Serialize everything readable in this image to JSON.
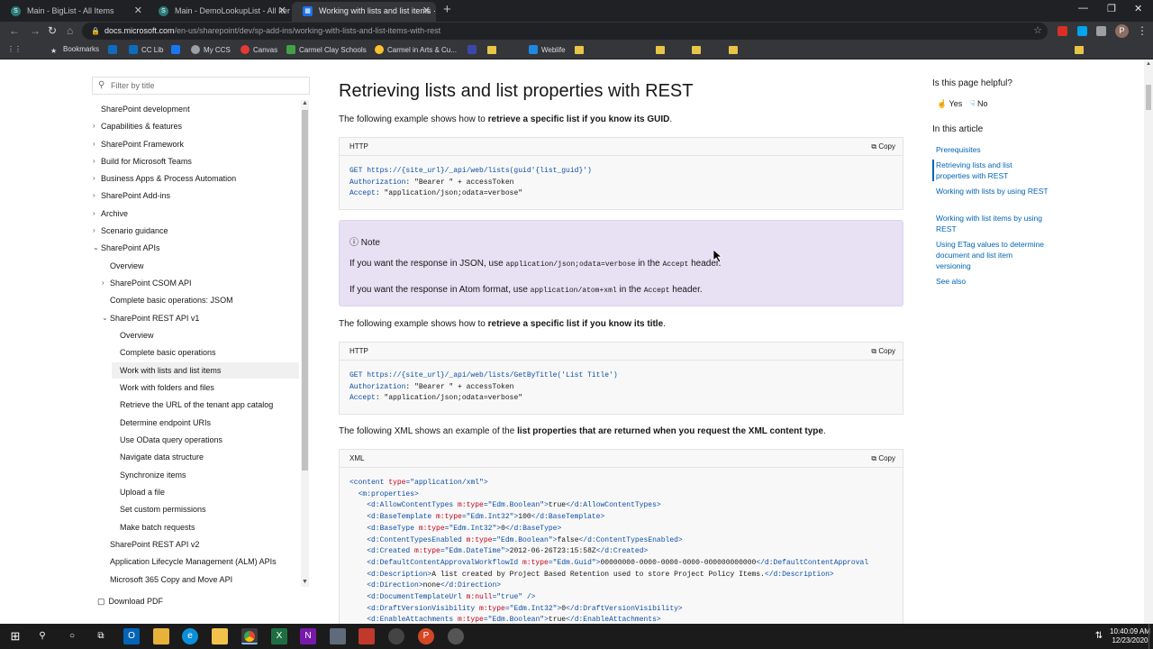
{
  "browser": {
    "tabs": [
      {
        "title": "Main - BigList - All Items",
        "icon": "sharepoint-icon"
      },
      {
        "title": "Main - DemoLookupList - All Iter",
        "icon": "sharepoint-icon"
      },
      {
        "title": "Working with lists and list items ·",
        "icon": "docs-icon"
      }
    ],
    "url_domain": "docs.microsoft.com",
    "url_path": "/en-us/sharepoint/dev/sp-add-ins/working-with-lists-and-list-items-with-rest",
    "profile_initial": "P",
    "bookmarks": [
      "Bookmarks",
      "CC Lib",
      "My CCS",
      "Canvas",
      "Carmel Clay Schools",
      "Carmel in Arts & Cu...",
      "Weblife"
    ]
  },
  "sidebar": {
    "filter_placeholder": "Filter by title",
    "download_pdf": "Download PDF",
    "items": [
      {
        "label": "SharePoint development"
      },
      {
        "label": "Capabilities & features"
      },
      {
        "label": "SharePoint Framework"
      },
      {
        "label": "Build for Microsoft Teams"
      },
      {
        "label": "Business Apps & Process Automation"
      },
      {
        "label": "SharePoint Add-ins"
      },
      {
        "label": "Archive"
      },
      {
        "label": "Scenario guidance"
      },
      {
        "label": "SharePoint APIs"
      },
      {
        "label": "Overview"
      },
      {
        "label": "SharePoint CSOM API"
      },
      {
        "label": "Complete basic operations: JSOM"
      },
      {
        "label": "SharePoint REST API v1"
      },
      {
        "label": "Overview"
      },
      {
        "label": "Complete basic operations"
      },
      {
        "label": "Work with lists and list items"
      },
      {
        "label": "Work with folders and files"
      },
      {
        "label": "Retrieve the URL of the tenant app catalog"
      },
      {
        "label": "Determine endpoint URIs"
      },
      {
        "label": "Use OData query operations"
      },
      {
        "label": "Navigate data structure"
      },
      {
        "label": "Synchronize items"
      },
      {
        "label": "Upload a file"
      },
      {
        "label": "Set custom permissions"
      },
      {
        "label": "Make batch requests"
      },
      {
        "label": "SharePoint REST API v2"
      },
      {
        "label": "Application Lifecycle Management (ALM) APIs"
      },
      {
        "label": "Microsoft 365 Copy and Move API"
      }
    ]
  },
  "main": {
    "title": "Retrieving lists and list properties with REST",
    "p1_a": "The following example shows how to ",
    "p1_b": "retrieve a specific list if you know its GUID",
    "p1_c": ".",
    "copy": "Copy",
    "code1_lang": "HTTP",
    "code1": {
      "l1a": "GET ",
      "l1b": "https://{site_url}/_api/web/lists(guid'{list_guid}')",
      "l2a": "Authorization",
      "l2b": ": \"Bearer \" + accessToken",
      "l3a": "Accept",
      "l3b": ": \"application/json;odata=verbose\""
    },
    "note_title": "Note",
    "note_l1_a": "If you want the response in JSON, use ",
    "note_l1_code": "application/json;odata=verbose",
    "note_l1_b": " in the ",
    "note_l1_code2": "Accept",
    "note_l1_c": " header.",
    "note_l2_a": "If you want the response in Atom format, use ",
    "note_l2_code": "application/atom+xml",
    "note_l2_b": " in the ",
    "note_l2_code2": "Accept",
    "note_l2_c": " header.",
    "p2_a": "The following example shows how to ",
    "p2_b": "retrieve a specific list if you know its title",
    "p2_c": ".",
    "code2_lang": "HTTP",
    "code2": {
      "l1a": "GET ",
      "l1b": "https://{site_url}/_api/web/lists/GetByTitle('List Title')",
      "l2a": "Authorization",
      "l2b": ": \"Bearer \" + accessToken",
      "l3a": "Accept",
      "l3b": ": \"application/json;odata=verbose\""
    },
    "p3_a": "The following XML shows an example of the ",
    "p3_b": "list properties that are returned when you request the XML content type",
    "p3_c": ".",
    "code3_lang": "XML",
    "xml": [
      {
        "pre": "",
        "open": "<content ",
        "attrs": [
          [
            "type",
            "\"application/xml\""
          ]
        ],
        "close": ">",
        "text": "",
        "end": ""
      },
      {
        "pre": "  ",
        "open": "<m:properties",
        "attrs": [],
        "close": ">",
        "text": "",
        "end": ""
      },
      {
        "pre": "    ",
        "open": "<d:AllowContentTypes ",
        "attrs": [
          [
            "m:type",
            "\"Edm.Boolean\""
          ]
        ],
        "close": ">",
        "text": "true",
        "end": "</d:AllowContentTypes>"
      },
      {
        "pre": "    ",
        "open": "<d:BaseTemplate ",
        "attrs": [
          [
            "m:type",
            "\"Edm.Int32\""
          ]
        ],
        "close": ">",
        "text": "100",
        "end": "</d:BaseTemplate>"
      },
      {
        "pre": "    ",
        "open": "<d:BaseType ",
        "attrs": [
          [
            "m:type",
            "\"Edm.Int32\""
          ]
        ],
        "close": ">",
        "text": "0",
        "end": "</d:BaseType>"
      },
      {
        "pre": "    ",
        "open": "<d:ContentTypesEnabled ",
        "attrs": [
          [
            "m:type",
            "\"Edm.Boolean\""
          ]
        ],
        "close": ">",
        "text": "false",
        "end": "</d:ContentTypesEnabled>"
      },
      {
        "pre": "    ",
        "open": "<d:Created ",
        "attrs": [
          [
            "m:type",
            "\"Edm.DateTime\""
          ]
        ],
        "close": ">",
        "text": "2012-06-26T23:15:58Z",
        "end": "</d:Created>"
      },
      {
        "pre": "    ",
        "open": "<d:DefaultContentApprovalWorkflowId ",
        "attrs": [
          [
            "m:type",
            "\"Edm.Guid\""
          ]
        ],
        "close": ">",
        "text": "00000000-0000-0000-0000-000000000000",
        "end": "</d:DefaultContentApproval"
      },
      {
        "pre": "    ",
        "open": "<d:Description",
        "attrs": [],
        "close": ">",
        "text": "A list created by Project Based Retention used to store Project Policy Items.",
        "end": "</d:Description>"
      },
      {
        "pre": "    ",
        "open": "<d:Direction",
        "attrs": [],
        "close": ">",
        "text": "none",
        "end": "</d:Direction>"
      },
      {
        "pre": "    ",
        "open": "<d:DocumentTemplateUrl ",
        "attrs": [
          [
            "m:null",
            "\"true\""
          ]
        ],
        "close": " />",
        "text": "",
        "end": ""
      },
      {
        "pre": "    ",
        "open": "<d:DraftVersionVisibility ",
        "attrs": [
          [
            "m:type",
            "\"Edm.Int32\""
          ]
        ],
        "close": ">",
        "text": "0",
        "end": "</d:DraftVersionVisibility>"
      },
      {
        "pre": "    ",
        "open": "<d:EnableAttachments ",
        "attrs": [
          [
            "m:type",
            "\"Edm.Boolean\""
          ]
        ],
        "close": ">",
        "text": "true",
        "end": "</d:EnableAttachments>"
      }
    ]
  },
  "rail": {
    "helpful": "Is this page helpful?",
    "yes": "Yes",
    "no": "No",
    "in_article": "In this article",
    "links": [
      "Prerequisites",
      "Retrieving lists and list properties with REST",
      "Working with lists by using REST",
      "Working with list items by using REST",
      "Using ETag values to determine document and list item versioning",
      "See also"
    ]
  },
  "taskbar": {
    "time": "10:40:09 AM",
    "date": "12/23/2020"
  }
}
